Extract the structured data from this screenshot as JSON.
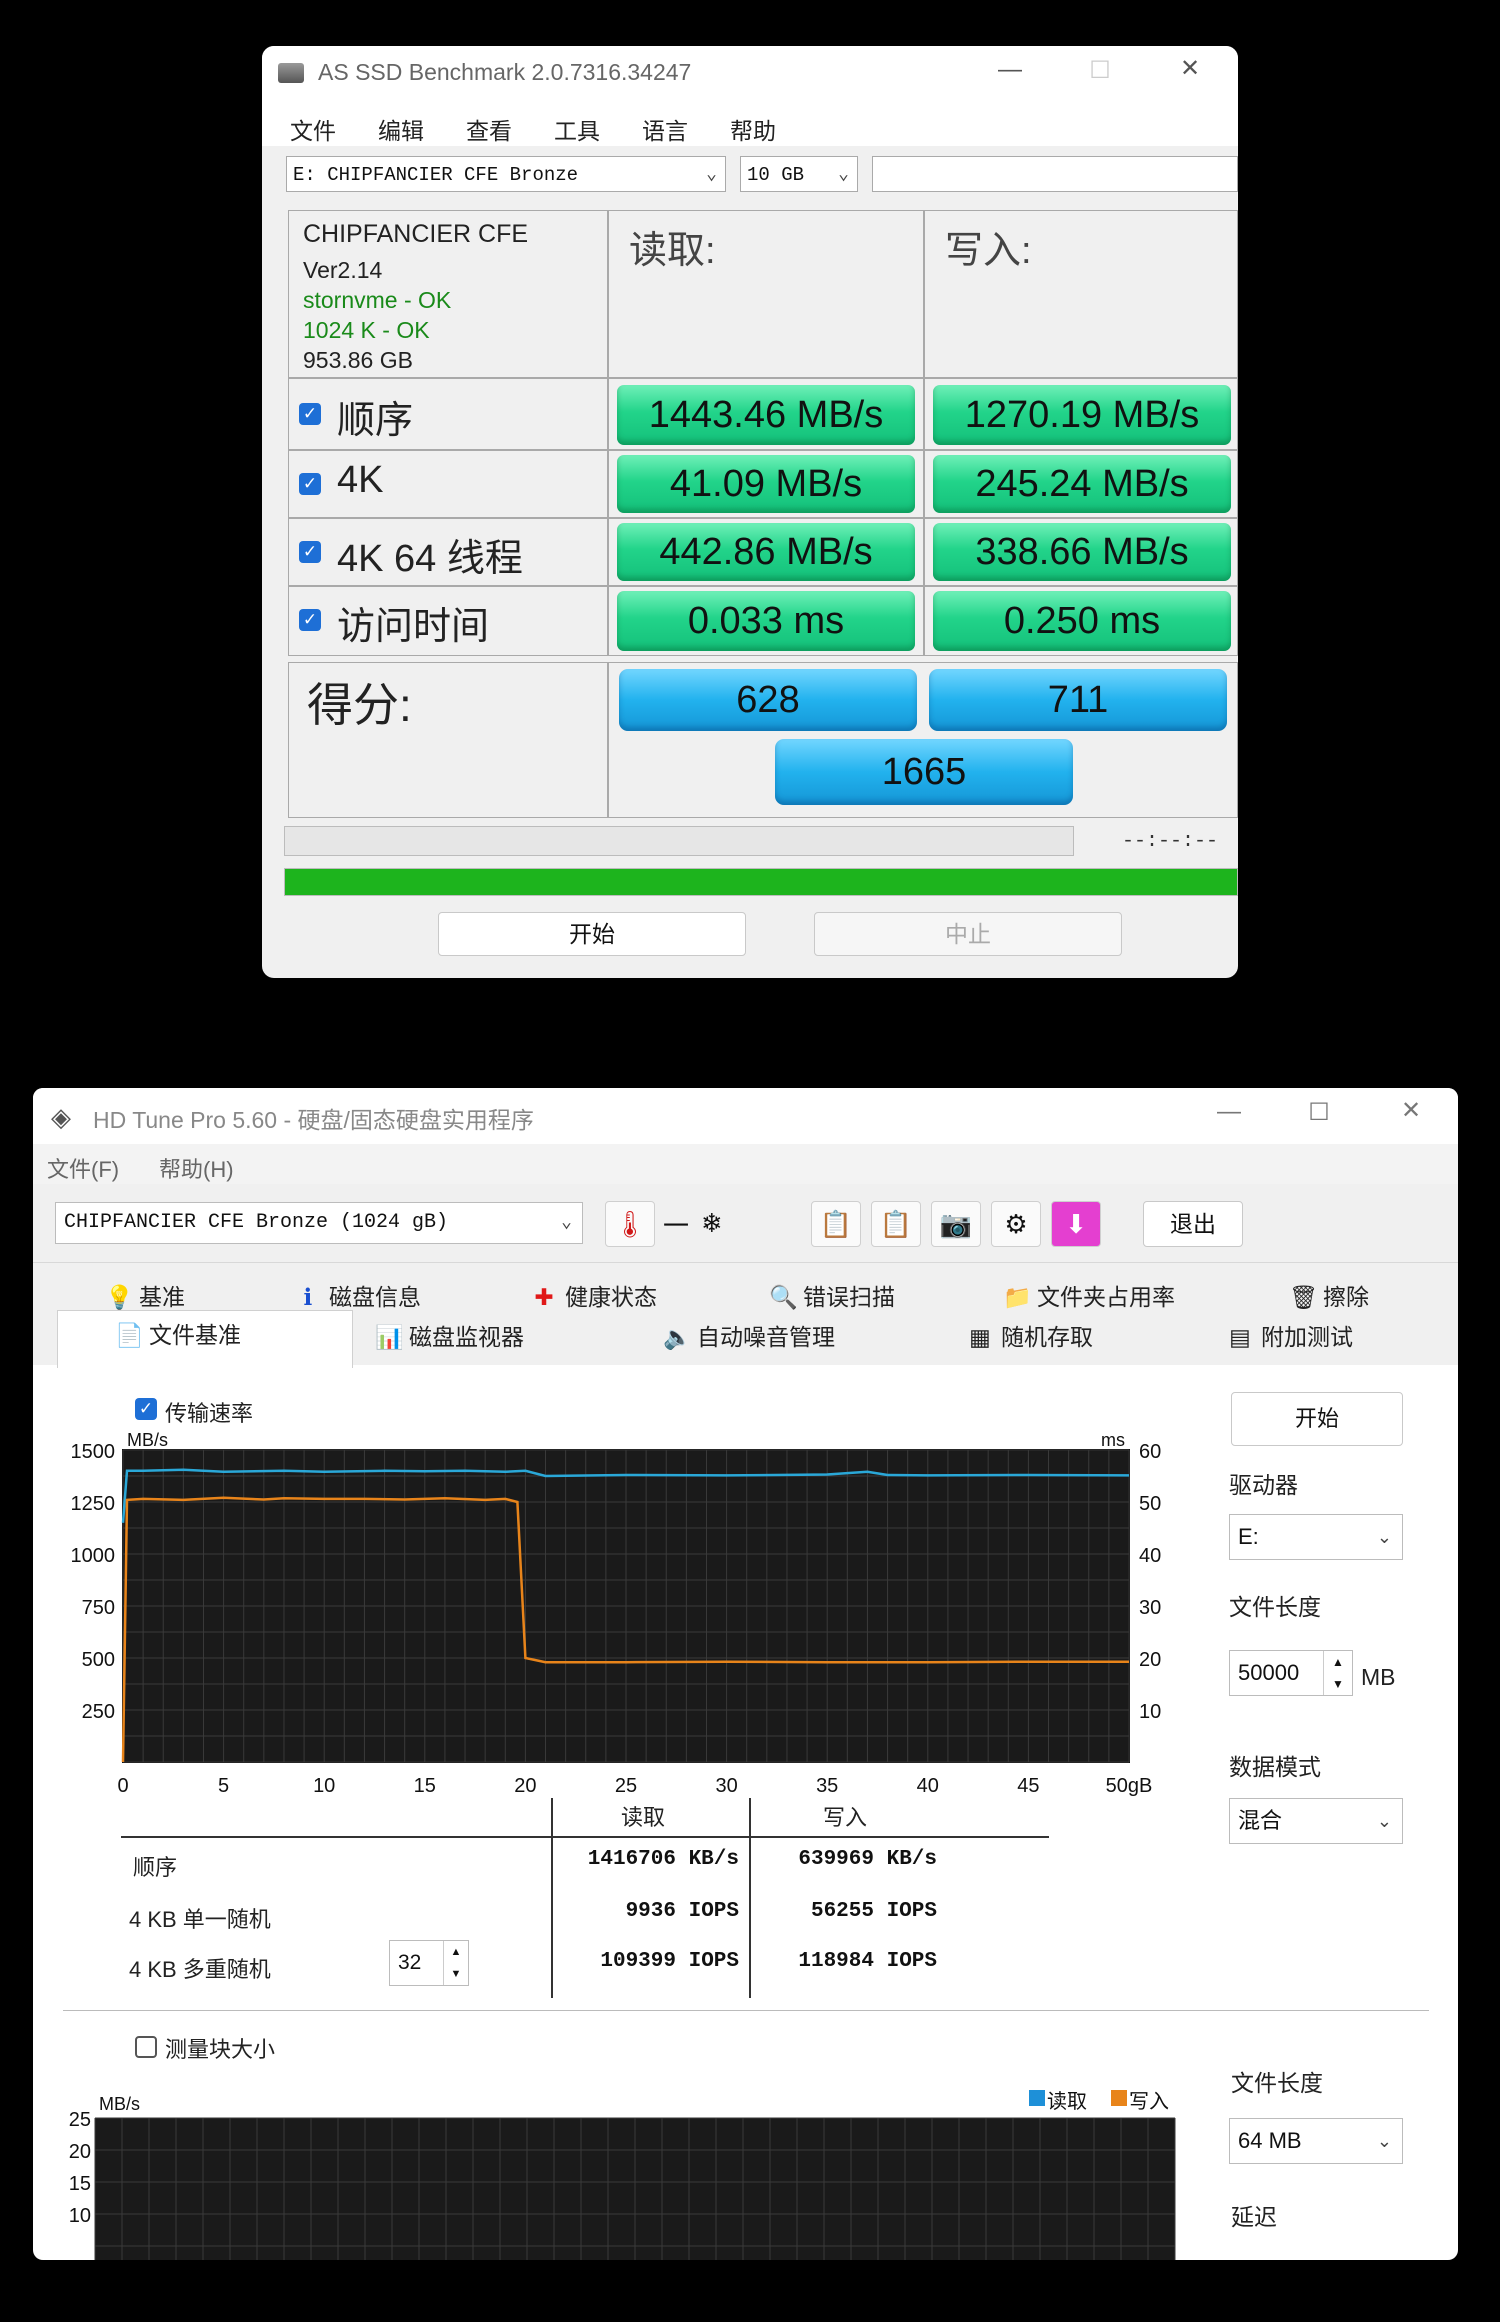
{
  "asssd": {
    "title": "AS SSD Benchmark 2.0.7316.34247",
    "menu": [
      "文件",
      "编辑",
      "查看",
      "工具",
      "语言",
      "帮助"
    ],
    "drive_select": "E: CHIPFANCIER CFE Bronze",
    "size_select": "10 GB",
    "drive_info": {
      "name": "CHIPFANCIER CFE",
      "version": "Ver2.14",
      "driver": "stornvme - OK",
      "alignment": "1024 K - OK",
      "capacity": "953.86 GB"
    },
    "col_read": "读取:",
    "col_write": "写入:",
    "rows": [
      {
        "label": "顺序",
        "read": "1443.46 MB/s",
        "write": "1270.19 MB/s"
      },
      {
        "label": "4K",
        "read": "41.09 MB/s",
        "write": "245.24 MB/s"
      },
      {
        "label": "4K 64 线程",
        "read": "442.86 MB/s",
        "write": "338.66 MB/s"
      },
      {
        "label": "访问时间",
        "read": "0.033 ms",
        "write": "0.250 ms"
      }
    ],
    "score_label": "得分:",
    "score_read": "628",
    "score_write": "711",
    "score_total": "1665",
    "time_text": "--:--:--",
    "progress": 1.0,
    "start_label": "开始",
    "abort_label": "中止"
  },
  "hdtune": {
    "title": "HD Tune Pro 5.60 - 硬盘/固态硬盘实用程序",
    "menu": [
      "文件(F)",
      "帮助(H)"
    ],
    "drive_select": "CHIPFANCIER CFE Bronze (1024 gB)",
    "temp_text": "一",
    "exit_label": "退出",
    "tabs_row1": [
      {
        "icon": "💡",
        "label": "基准"
      },
      {
        "icon": "ℹ",
        "label": "磁盘信息"
      },
      {
        "icon": "✚",
        "label": "健康状态"
      },
      {
        "icon": "🔍",
        "label": "错误扫描"
      },
      {
        "icon": "📁",
        "label": "文件夹占用率"
      },
      {
        "icon": "🗑",
        "label": "擦除"
      }
    ],
    "tabs_row2": [
      {
        "icon": "📄",
        "label": "文件基准"
      },
      {
        "icon": "📊",
        "label": "磁盘监视器"
      },
      {
        "icon": "🔈",
        "label": "自动噪音管理"
      },
      {
        "icon": "▦",
        "label": "随机存取"
      },
      {
        "icon": "▤",
        "label": "附加测试"
      }
    ],
    "transfer_rate_label": "传输速率",
    "start_label": "开始",
    "drive_label": "驱动器",
    "drive_value": "E:",
    "file_length_label": "文件长度",
    "file_length_value": "50000",
    "file_length_unit": "MB",
    "data_mode_label": "数据模式",
    "data_mode_value": "混合",
    "chart_data": {
      "type": "line",
      "xlabel": "gB",
      "ylabel_left": "MB/s",
      "ylabel_right": "ms",
      "x_ticks": [
        "0",
        "5",
        "10",
        "15",
        "20",
        "25",
        "30",
        "35",
        "40",
        "45",
        "50gB"
      ],
      "y_left_ticks": [
        "1500",
        "1250",
        "1000",
        "750",
        "500",
        "250"
      ],
      "y_right_ticks": [
        "60",
        "50",
        "40",
        "30",
        "20",
        "10"
      ],
      "xlim": [
        0,
        50
      ],
      "ylim_left": [
        0,
        1500
      ],
      "ylim_right": [
        0,
        60
      ],
      "grid": true,
      "series": [
        {
          "name": "读取",
          "color": "#2aa8d8",
          "x": [
            0,
            0.2,
            1,
            3,
            5,
            8,
            10,
            13,
            15,
            17,
            19,
            20,
            21,
            25,
            30,
            35,
            37,
            38,
            40,
            45,
            50
          ],
          "values": [
            1150,
            1400,
            1400,
            1405,
            1395,
            1400,
            1395,
            1400,
            1398,
            1400,
            1395,
            1400,
            1375,
            1380,
            1378,
            1382,
            1395,
            1380,
            1378,
            1380,
            1378
          ]
        },
        {
          "name": "写入",
          "color": "#e8841a",
          "x": [
            0,
            0.2,
            1,
            3,
            5,
            7,
            8,
            10,
            12,
            14,
            16,
            18,
            19,
            19.6,
            20,
            21,
            25,
            30,
            35,
            40,
            45,
            50
          ],
          "values": [
            0,
            1260,
            1265,
            1260,
            1270,
            1262,
            1268,
            1265,
            1265,
            1262,
            1268,
            1260,
            1265,
            1250,
            500,
            480,
            480,
            482,
            480,
            480,
            482,
            482
          ]
        }
      ]
    },
    "results": {
      "header_read": "读取",
      "header_write": "写入",
      "rows": [
        {
          "label": "顺序",
          "read": "1416706 KB/s",
          "write": "639969 KB/s"
        },
        {
          "label": "4 KB 单一随机",
          "read": "9936 IOPS",
          "write": "56255 IOPS"
        },
        {
          "label": "4 KB 多重随机",
          "read": "109399 IOPS",
          "write": "118984 IOPS"
        }
      ],
      "queue_depth": "32"
    },
    "block_size_label": "测量块大小",
    "lower_chart": {
      "ylabel": "MB/s",
      "y_ticks": [
        "25",
        "20",
        "15",
        "10"
      ],
      "legend_read": "读取",
      "legend_write": "写入",
      "read_color": "#1e90d8",
      "write_color": "#e8841a"
    },
    "file_length_label2": "文件长度",
    "file_length_value2": "64 MB",
    "delay_label": "延迟"
  }
}
